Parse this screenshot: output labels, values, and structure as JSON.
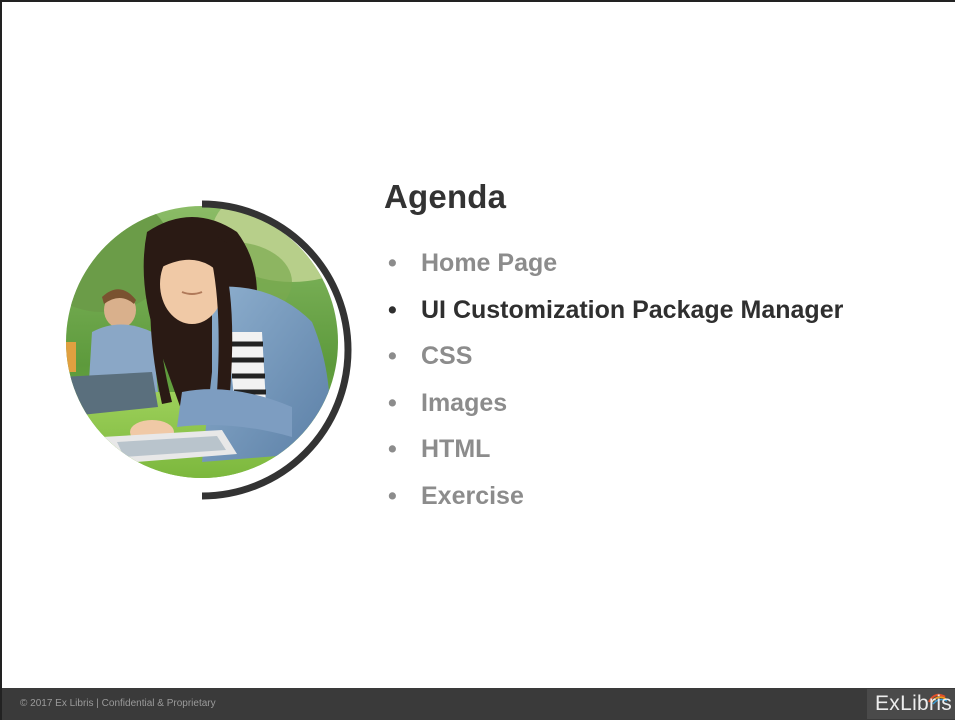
{
  "slide": {
    "title": "Agenda",
    "items": [
      {
        "label": "Home Page",
        "bullet": "•",
        "active": false
      },
      {
        "label": "UI Customization Package Manager",
        "bullet": "•",
        "active": true
      },
      {
        "label": "CSS",
        "bullet": "•",
        "active": false
      },
      {
        "label": "Images",
        "bullet": "•",
        "active": false
      },
      {
        "label": "HTML",
        "bullet": "•",
        "active": false
      },
      {
        "label": "Exercise",
        "bullet": "•",
        "active": false
      }
    ]
  },
  "footer": {
    "copyright": "© 2017 Ex Libris | Confidential & Proprietary",
    "logo_text": "ExLibris"
  },
  "colors": {
    "active_item": "#2f2f2f",
    "inactive_item": "#8c8c8c",
    "footer_bg": "#3a3a3a",
    "arc": "#333333"
  }
}
